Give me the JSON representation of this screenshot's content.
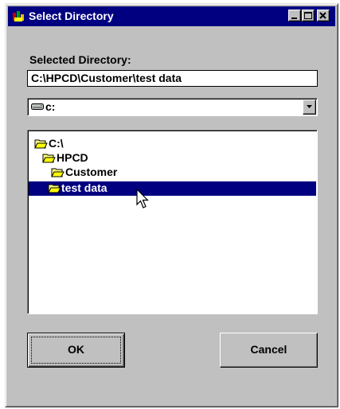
{
  "window": {
    "title": "Select Directory",
    "title_bar_color": "#000080",
    "face_color": "#c0c0c0",
    "controls": [
      "minimize-icon",
      "maximize-icon",
      "close-icon"
    ]
  },
  "selected_directory": {
    "label": "Selected Directory:",
    "value": "C:\\HPCD\\Customer\\test data"
  },
  "drive": {
    "icon": "drive-icon",
    "value": "c:"
  },
  "tree": {
    "items": [
      {
        "label": "C:\\",
        "icon": "open-folder-icon",
        "selected": false
      },
      {
        "label": "HPCD",
        "icon": "open-folder-icon",
        "selected": false
      },
      {
        "label": "Customer",
        "icon": "open-folder-icon",
        "selected": false
      },
      {
        "label": "test data",
        "icon": "open-folder-icon",
        "selected": true
      }
    ],
    "selection_color": "#000080"
  },
  "buttons": {
    "ok_label": "OK",
    "cancel_label": "Cancel"
  }
}
